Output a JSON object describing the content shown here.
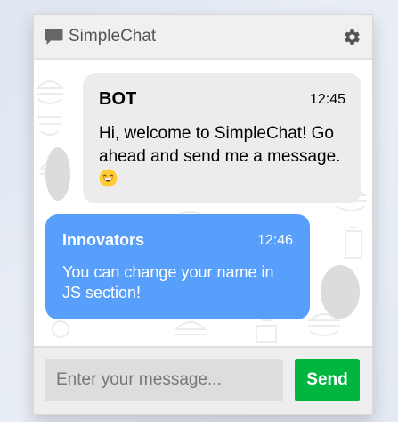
{
  "app": {
    "title": "SimpleChat",
    "chat_icon": "chat-bubble-icon",
    "settings_icon": "gear-icon"
  },
  "messages": [
    {
      "sender": "BOT",
      "time": "12:45",
      "text": "Hi, welcome to SimpleChat! Go ahead and send me a message.",
      "emoji": "grinning-face-emoji",
      "side": "left"
    },
    {
      "sender": "Innovators",
      "time": "12:46",
      "text": "You can change your name in JS section!",
      "side": "right"
    }
  ],
  "input": {
    "placeholder": "Enter your message...",
    "value": ""
  },
  "send": {
    "label": "Send"
  },
  "colors": {
    "header_bg": "#f0f0f0",
    "bot_bubble": "#ececec",
    "user_bubble": "#579ffb",
    "send_button": "#00b63e",
    "input_bg": "#dddddd"
  }
}
